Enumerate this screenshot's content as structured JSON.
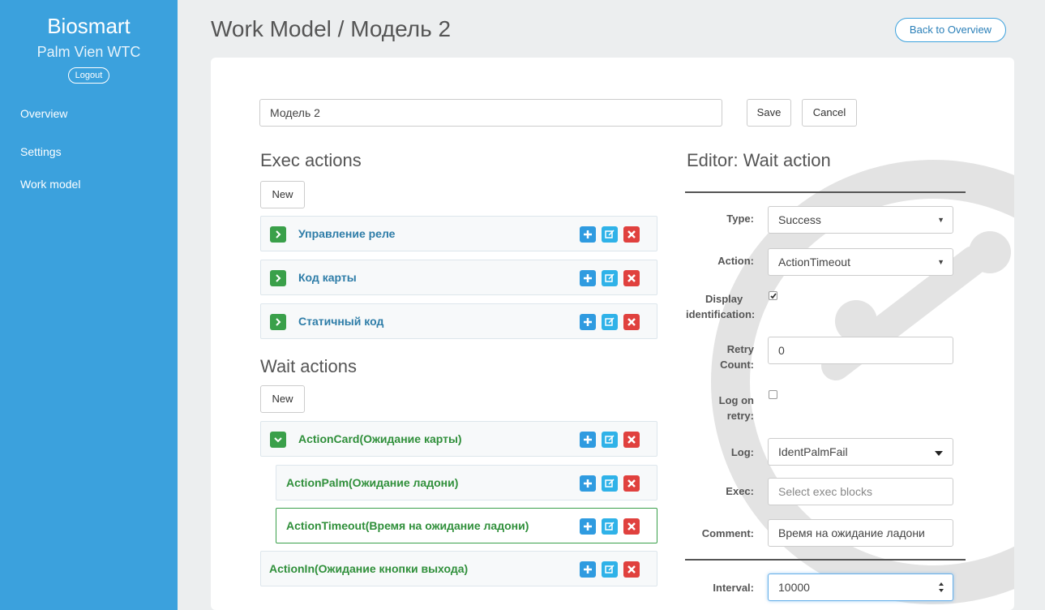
{
  "sidebar": {
    "brand": "Biosmart",
    "site": "Palm Vien WTC",
    "logout": "Logout",
    "nav": [
      "Overview",
      "Settings",
      "Work model"
    ]
  },
  "header": {
    "title": "Work Model / Модель 2",
    "back_label": "Back to Overview"
  },
  "form": {
    "name_value": "Модель 2",
    "save_label": "Save",
    "cancel_label": "Cancel"
  },
  "exec": {
    "title": "Exec actions",
    "new_label": "New",
    "items": [
      "Управление реле",
      "Код карты",
      "Статичный код"
    ]
  },
  "wait": {
    "title": "Wait actions",
    "new_label": "New",
    "items": [
      "ActionCard(Ожидание карты)",
      "ActionPalm(Ожидание ладони)",
      "ActionTimeout(Время на ожидание ладони)",
      "ActionIn(Ожидание кнопки выхода)"
    ]
  },
  "editor": {
    "title": "Editor: Wait action",
    "type_label": "Type:",
    "type_value": "Success",
    "action_label": "Action:",
    "action_value": "ActionTimeout",
    "display_label_1": "Display",
    "display_label_2": "identification:",
    "display_checked": true,
    "retry_label_1": "Retry",
    "retry_label_2": "Count:",
    "retry_value": "0",
    "logretry_label_1": "Log on",
    "logretry_label_2": "retry:",
    "logretry_checked": false,
    "log_label": "Log:",
    "log_value": "IdentPalmFail",
    "exec_label": "Exec:",
    "exec_placeholder": "Select exec blocks",
    "comment_label": "Comment:",
    "comment_value": "Время на ожидание ладони",
    "interval_label": "Interval:",
    "interval_value": "10000"
  },
  "colors": {
    "sidebar": "#3ba1dd",
    "success": "#3aa04a",
    "primary": "#2f9be0",
    "danger": "#e0413e"
  }
}
